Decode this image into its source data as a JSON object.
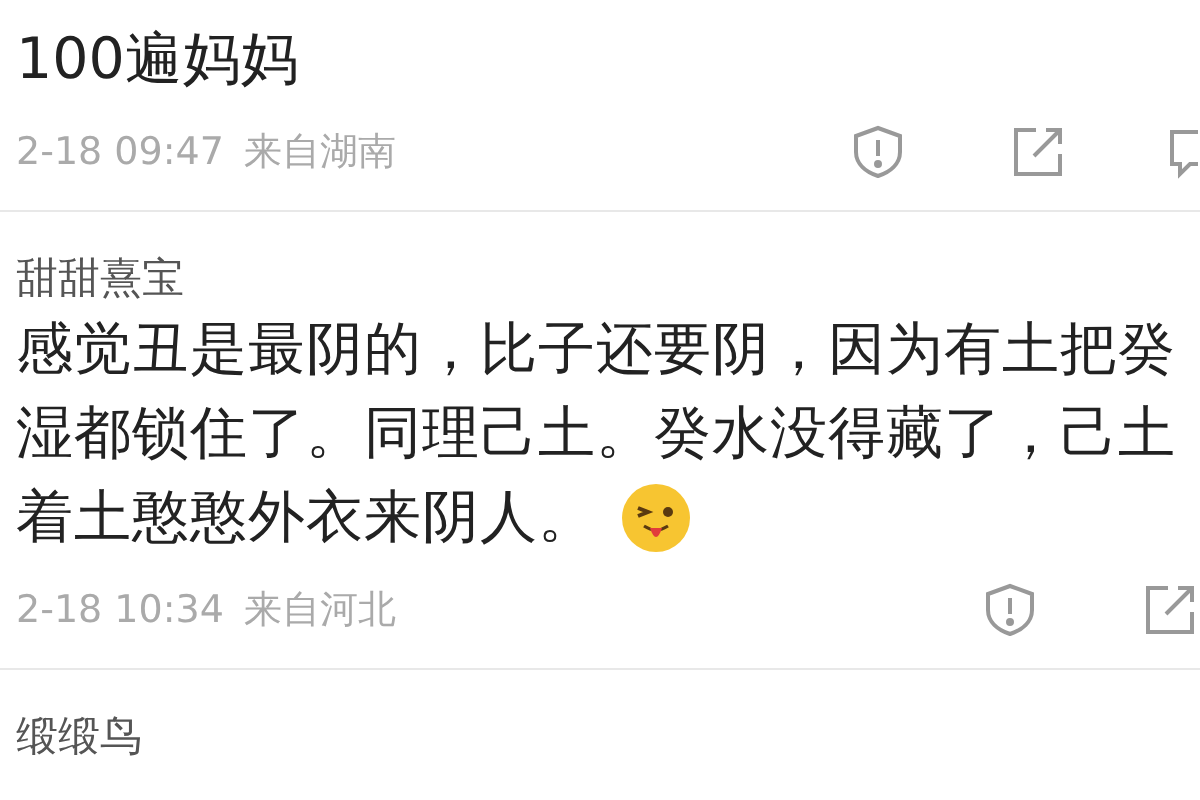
{
  "comments": [
    {
      "lines": [
        "100遍妈妈"
      ],
      "time": "2-18 09:47",
      "location": "来自湖南",
      "actions": [
        {
          "kind": "report"
        },
        {
          "kind": "share"
        },
        {
          "kind": "comment"
        }
      ]
    },
    {
      "author": "甜甜熹宝",
      "lines": [
        "感觉丑是最阴的，比子还要阴，因为有土把癸",
        "湿都锁住了。同理己土。癸水没得藏了，己土",
        "着土憨憨外衣来阴人。"
      ],
      "emoji": true,
      "time": "2-18 10:34",
      "location": "来自河北",
      "actions": [
        {
          "kind": "report"
        },
        {
          "kind": "share"
        }
      ]
    },
    {
      "author": "缎缎鸟"
    }
  ]
}
